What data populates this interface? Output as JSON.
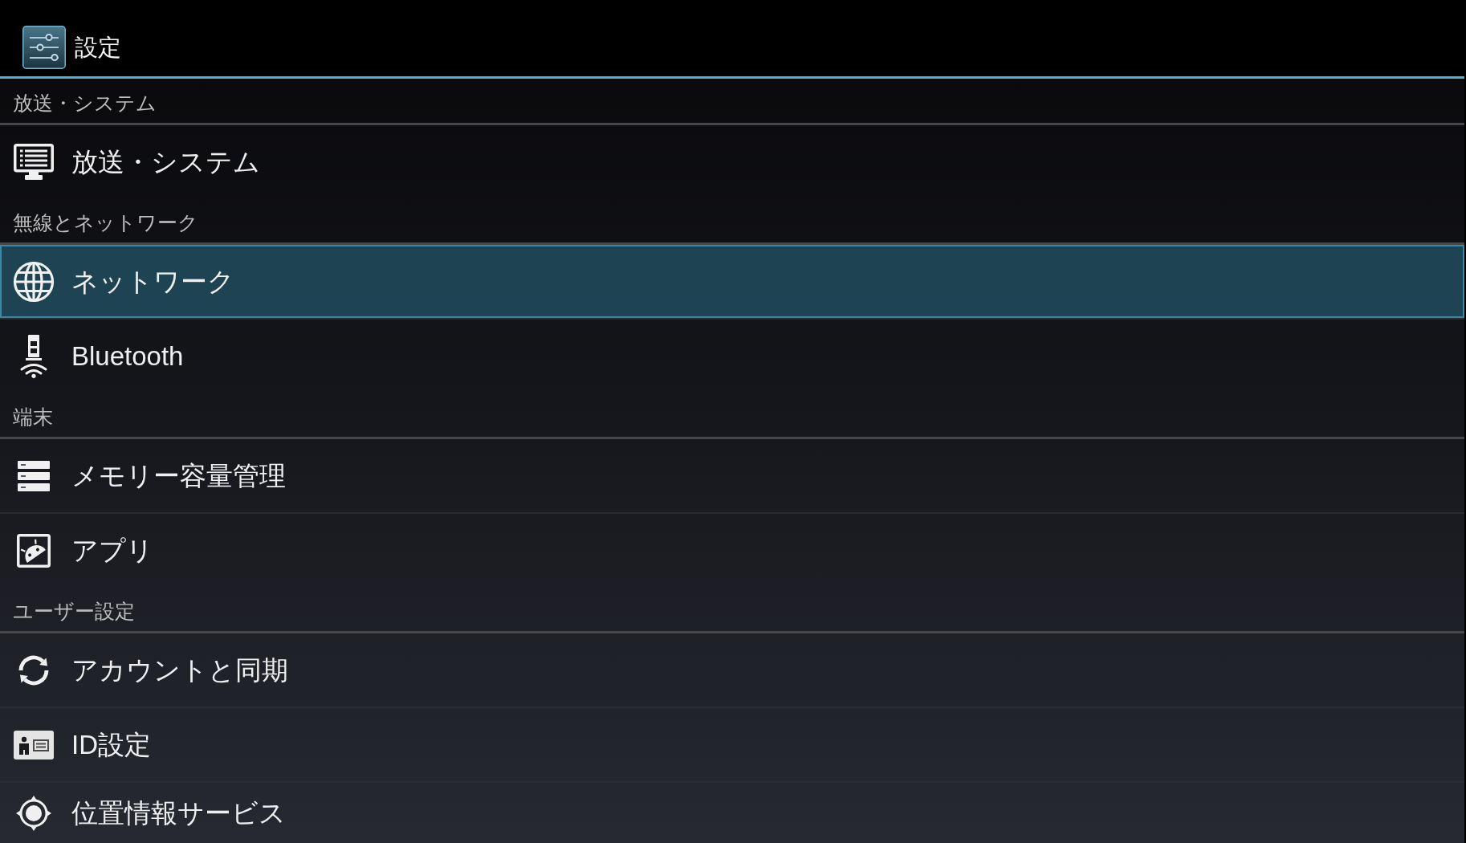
{
  "action_bar": {
    "title": "設定"
  },
  "sections": [
    {
      "header": "放送・システム",
      "items": [
        {
          "kind": "broadcast",
          "label": "放送・システム",
          "selected": false
        }
      ]
    },
    {
      "header": "無線とネットワーク",
      "items": [
        {
          "kind": "network",
          "label": "ネットワーク",
          "selected": true
        },
        {
          "kind": "bluetooth",
          "label": "Bluetooth",
          "selected": false
        }
      ]
    },
    {
      "header": "端末",
      "items": [
        {
          "kind": "storage",
          "label": "メモリー容量管理",
          "selected": false
        },
        {
          "kind": "apps",
          "label": "アプリ",
          "selected": false
        }
      ]
    },
    {
      "header": "ユーザー設定",
      "items": [
        {
          "kind": "accounts",
          "label": "アカウントと同期",
          "selected": false
        },
        {
          "kind": "id",
          "label": "ID設定",
          "selected": false
        },
        {
          "kind": "location",
          "label": "位置情報サービス",
          "selected": false
        }
      ]
    }
  ]
}
